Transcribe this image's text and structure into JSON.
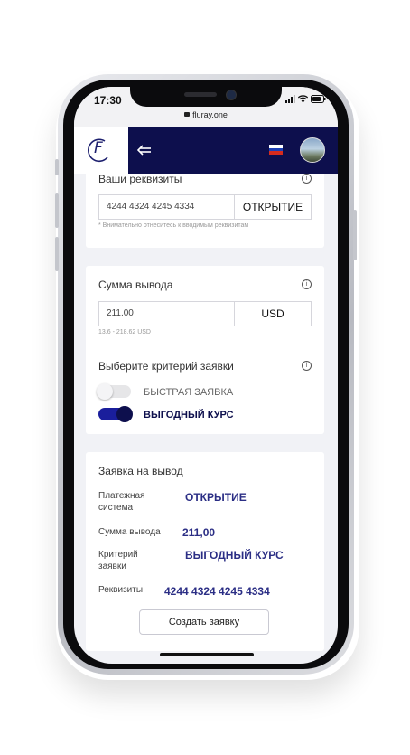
{
  "status_bar": {
    "time": "17:30",
    "url": "fluray.one"
  },
  "header": {
    "logo_letter": "F",
    "back_icon": "back-arrow-icon",
    "language_flag": "russia-flag",
    "avatar_icon": "user-avatar"
  },
  "requisites_card": {
    "title": "Ваши реквизиты",
    "card_number_value": "4244 4324 4245 4334",
    "bank_label": "ОТКРЫТИЕ",
    "hint": "* Внимательно отнеситесь к вводимым реквизитам"
  },
  "amount_card": {
    "title": "Сумма вывода",
    "amount_value": "211.00",
    "currency": "USD",
    "range_hint": "13.6 - 218.62 USD",
    "criteria_title": "Выберите критерий заявки",
    "options": [
      {
        "label": "БЫСТРАЯ ЗАЯВКА",
        "enabled": false
      },
      {
        "label": "ВЫГОДНЫЙ КУРС",
        "enabled": true
      }
    ]
  },
  "summary_card": {
    "title": "Заявка на вывод",
    "payment_system_label_1": "Платежная",
    "payment_system_label_2": "система",
    "payment_system_value": "ОТКРЫТИЕ",
    "amount_label": "Сумма вывода",
    "amount_value": "211,00",
    "criteria_label_1": "Критерий",
    "criteria_label_2": "заявки",
    "criteria_value": "ВЫГОДНЫЙ КУРС",
    "requisites_label": "Реквизиты",
    "requisites_value": "4244 4324 4245 4334",
    "create_button": "Создать заявку"
  },
  "colors": {
    "header_bg": "#0d0f4d",
    "accent": "#2b2e85",
    "toggle_on": "#1a1e9c"
  }
}
